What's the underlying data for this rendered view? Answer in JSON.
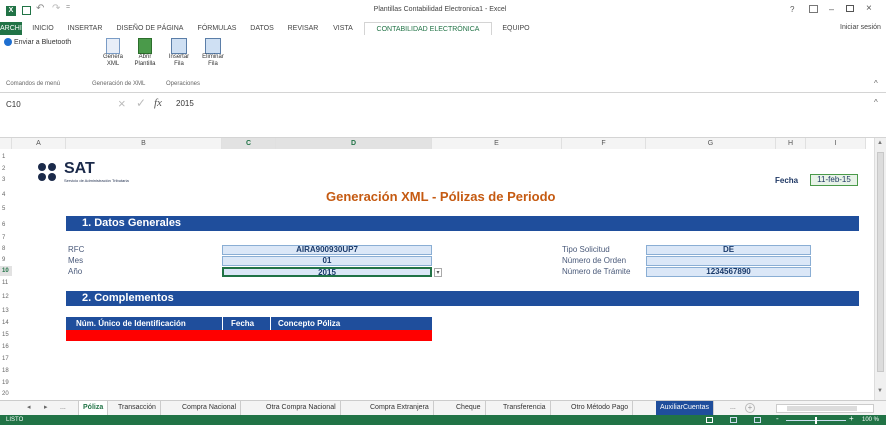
{
  "app": {
    "window_title": "Plantillas Contabilidad Electronica1 - Excel",
    "help": "?",
    "sign_in": "Iniciar sesión"
  },
  "tabs": [
    "ARCHIVO",
    "INICIO",
    "INSERTAR",
    "DISEÑO DE PÁGINA",
    "FÓRMULAS",
    "DATOS",
    "REVISAR",
    "VISTA",
    "CONTABILIDAD ELECTRÓNICA",
    "EQUIPO"
  ],
  "ribbon": {
    "bluetooth": "Enviar a Bluetooth",
    "group_menu": "Comandos de menú",
    "group_xml": "Generación de XML",
    "group_ops": "Operaciones",
    "btn_genera": "Genera",
    "btn_genera2": "XML",
    "btn_abrir": "Abrir",
    "btn_abrir2": "Plantilla",
    "btn_insertar": "Insertar",
    "btn_insertar2": "Fila",
    "btn_eliminar": "Eliminar",
    "btn_eliminar2": "Fila"
  },
  "formula": {
    "namebox": "C10",
    "fx": "fx",
    "value": "2015"
  },
  "columns": [
    "A",
    "B",
    "C",
    "D",
    "E",
    "F",
    "G",
    "H",
    "I"
  ],
  "rows": [
    "1",
    "2",
    "3",
    "4",
    "5",
    "6",
    "7",
    "8",
    "9",
    "10",
    "11",
    "12",
    "13",
    "14",
    "15",
    "16",
    "17",
    "18",
    "19",
    "20"
  ],
  "sheet": {
    "logo": "SAT",
    "logo_sub": "Servicio de Administración Tributaria",
    "title": "Generación XML - Pólizas de Periodo",
    "fecha_label": "Fecha",
    "fecha_value": "11-feb-15",
    "section1": "1. Datos Generales",
    "rfc_label": "RFC",
    "rfc_value": "AIRA900930UP7",
    "mes_label": "Mes",
    "mes_value": "01",
    "anio_label": "Año",
    "anio_value": "2015",
    "tipo_label": "Tipo Solicitud",
    "tipo_value": "DE",
    "orden_label": "Número de Orden",
    "orden_value": "",
    "tramite_label": "Número de Trámite",
    "tramite_value": "1234567890",
    "section2": "2. Complementos",
    "th1": "Núm. Único de Identificación",
    "th2": "Fecha",
    "th3": "Concepto Póliza"
  },
  "sheet_tabs": [
    "Póliza",
    "Transacción",
    "Compra Nacional",
    "Otra Compra Nacional",
    "Compra Extranjera",
    "Cheque",
    "Transferencia",
    "Otro Método Pago",
    "AuxiliarCuentas"
  ],
  "sheet_nav": {
    "ellipsis": "...",
    "ellipsis2": "..."
  },
  "status": {
    "ready": "LISTO",
    "zoom": "100 %"
  },
  "colors": {
    "excel_green": "#217346",
    "band_blue": "#1f4e9c",
    "title_orange": "#c55a11",
    "red": "#ff0000"
  }
}
